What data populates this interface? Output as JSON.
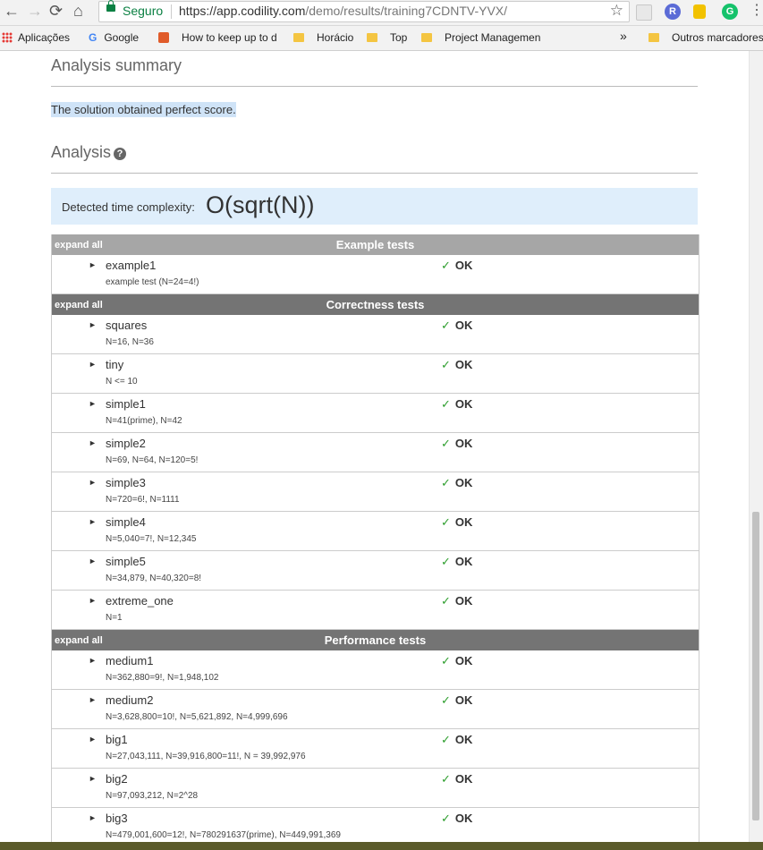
{
  "browser": {
    "back": "←",
    "forward": "→",
    "reload": "⟳",
    "home": "⌂",
    "secure_label": "Seguro",
    "url_host": "https://app.codility.com",
    "url_path": "/demo/results/training7CDNTV-YVX/",
    "star": "☆",
    "extensions": [
      {
        "name": "R",
        "color": "#5b6bd6"
      },
      {
        "name": "G",
        "color": "#15c26b"
      }
    ],
    "bookmarks": [
      {
        "label": "Aplicações"
      },
      {
        "label": "Google"
      },
      {
        "label": "How to keep up to d"
      },
      {
        "label": "Horácio"
      },
      {
        "label": "Top"
      },
      {
        "label": "Project Managemen"
      },
      {
        "label": "Outros marcadores"
      }
    ],
    "more": "»"
  },
  "page": {
    "summary_title": "Analysis summary",
    "summary_text": "The solution obtained perfect score.",
    "analysis_title": "Analysis",
    "help": "?",
    "complexity_label": "Detected time complexity:",
    "complexity_value": "O(sqrt(N))"
  },
  "groups": [
    {
      "title": "Example tests",
      "expand": "expand all",
      "tests": [
        {
          "name": "example1",
          "desc": "example test (N=24=4!)",
          "status": "OK"
        }
      ]
    },
    {
      "title": "Correctness tests",
      "expand": "expand all",
      "tests": [
        {
          "name": "squares",
          "desc": "N=16, N=36",
          "status": "OK"
        },
        {
          "name": "tiny",
          "desc": "N <= 10",
          "status": "OK"
        },
        {
          "name": "simple1",
          "desc": "N=41(prime), N=42",
          "status": "OK"
        },
        {
          "name": "simple2",
          "desc": "N=69, N=64, N=120=5!",
          "status": "OK"
        },
        {
          "name": "simple3",
          "desc": "N=720=6!, N=1111",
          "status": "OK"
        },
        {
          "name": "simple4",
          "desc": "N=5,040=7!, N=12,345",
          "status": "OK"
        },
        {
          "name": "simple5",
          "desc": "N=34,879, N=40,320=8!",
          "status": "OK"
        },
        {
          "name": "extreme_one",
          "desc": "N=1",
          "status": "OK"
        }
      ]
    },
    {
      "title": "Performance tests",
      "expand": "expand all",
      "tests": [
        {
          "name": "medium1",
          "desc": "N=362,880=9!, N=1,948,102",
          "status": "OK"
        },
        {
          "name": "medium2",
          "desc": "N=3,628,800=10!, N=5,621,892, N=4,999,696",
          "status": "OK"
        },
        {
          "name": "big1",
          "desc": "N=27,043,111, N=39,916,800=11!, N = 39,992,976",
          "status": "OK"
        },
        {
          "name": "big2",
          "desc": "N=97,093,212, N=2^28",
          "status": "OK"
        },
        {
          "name": "big3",
          "desc": "N=479,001,600=12!, N=780291637(prime), N=449,991,369",
          "status": "OK"
        }
      ]
    }
  ]
}
